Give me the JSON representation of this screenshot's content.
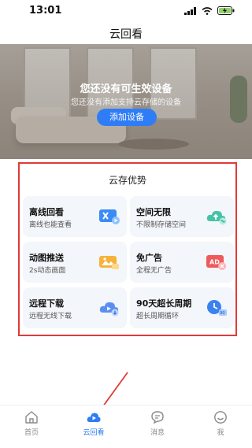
{
  "status_bar": {
    "time": "13:01"
  },
  "page": {
    "title": "云回看"
  },
  "hero": {
    "title": "您还没有可生效设备",
    "subtitle": "您还没有添加支持云存储的设备",
    "button_label": "添加设备"
  },
  "advantages": {
    "title": "云存优势",
    "items": [
      {
        "title": "离线回看",
        "subtitle": "离线也能查看",
        "icon": "offline-playback-icon"
      },
      {
        "title": "空间无限",
        "subtitle": "不限制存储空间",
        "icon": "unlimited-storage-icon"
      },
      {
        "title": "动图推送",
        "subtitle": "2s动态画面",
        "icon": "gif-push-icon"
      },
      {
        "title": "免广告",
        "subtitle": "全程无广告",
        "icon": "ad-free-icon"
      },
      {
        "title": "远程下载",
        "subtitle": "远程无线下载",
        "icon": "cloud-download-icon"
      },
      {
        "title": "90天超长周期",
        "subtitle": "超长周期循环",
        "icon": "long-cycle-clock-icon"
      }
    ]
  },
  "tabs": [
    {
      "label": "首页",
      "icon": "home-icon",
      "active": false
    },
    {
      "label": "云回看",
      "icon": "cloud-playback-icon",
      "active": true
    },
    {
      "label": "消息",
      "icon": "message-icon",
      "active": false
    },
    {
      "label": "我",
      "icon": "profile-icon",
      "active": false
    }
  ],
  "colors": {
    "accent": "#2f7df6",
    "highlight_frame": "#e03a3a",
    "tile_bg": "#f3f6fa"
  }
}
